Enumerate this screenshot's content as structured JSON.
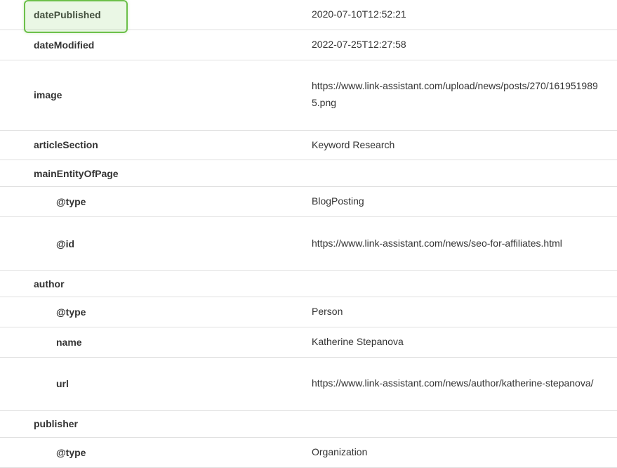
{
  "rows": {
    "datePublished": {
      "label": "datePublished",
      "value": "2020-07-10T12:52:21"
    },
    "dateModified": {
      "label": "dateModified",
      "value": "2022-07-25T12:27:58"
    },
    "image": {
      "label": "image",
      "value": "https://www.link-assistant.com/upload/news/posts/270/1619519895.png"
    },
    "articleSection": {
      "label": "articleSection",
      "value": "Keyword Research"
    },
    "mainEntityOfPage": {
      "label": "mainEntityOfPage"
    },
    "mainEntityOfPage_type": {
      "label": "@type",
      "value": "BlogPosting"
    },
    "mainEntityOfPage_id": {
      "label": "@id",
      "value": "https://www.link-assistant.com/news/seo-for-affiliates.html"
    },
    "author": {
      "label": "author"
    },
    "author_type": {
      "label": "@type",
      "value": "Person"
    },
    "author_name": {
      "label": "name",
      "value": "Katherine Stepanova"
    },
    "author_url": {
      "label": "url",
      "value": "https://www.link-assistant.com/news/author/katherine-stepanova/"
    },
    "publisher": {
      "label": "publisher"
    },
    "publisher_type": {
      "label": "@type",
      "value": "Organization"
    }
  }
}
